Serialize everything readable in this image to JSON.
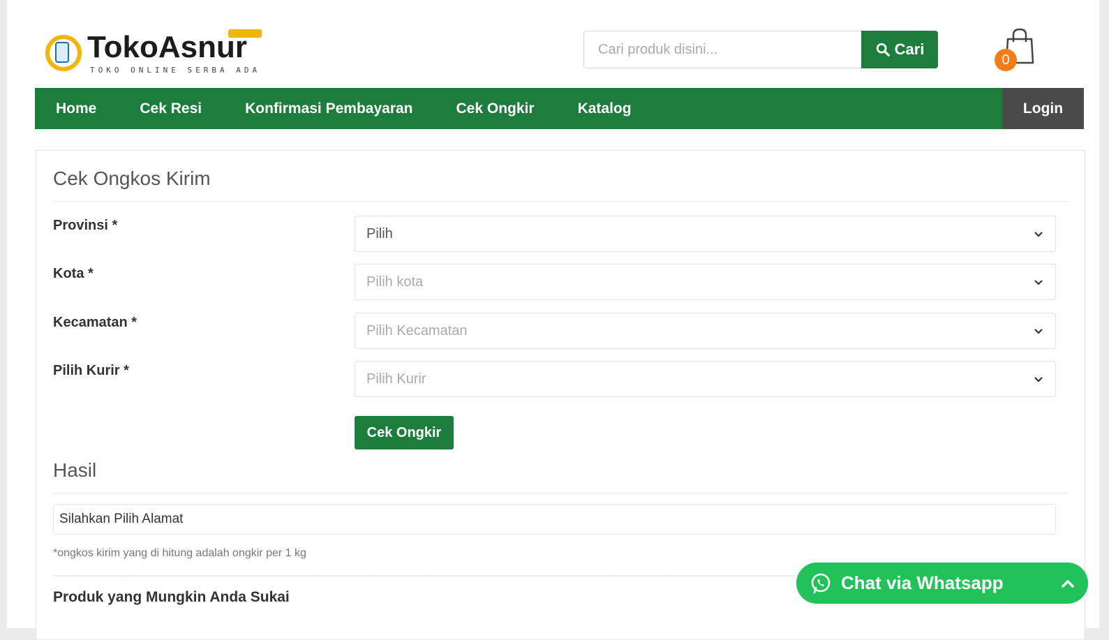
{
  "brand": {
    "name": "TokoAsnur",
    "tagline": "TOKO ONLINE SERBA ADA"
  },
  "search": {
    "placeholder": "Cari produk disini...",
    "button_label": "Cari"
  },
  "cart": {
    "count": "0"
  },
  "nav": {
    "items": [
      {
        "label": "Home"
      },
      {
        "label": "Cek Resi"
      },
      {
        "label": "Konfirmasi Pembayaran"
      },
      {
        "label": "Cek Ongkir"
      },
      {
        "label": "Katalog"
      }
    ],
    "login_label": "Login"
  },
  "form": {
    "title": "Cek Ongkos Kirim",
    "fields": [
      {
        "label": "Provinsi *",
        "value": "Pilih"
      },
      {
        "label": "Kota *",
        "value": "Pilih kota"
      },
      {
        "label": "Kecamatan *",
        "value": "Pilih Kecamatan"
      },
      {
        "label": "Pilih Kurir *",
        "value": "Pilih Kurir"
      }
    ],
    "submit_label": "Cek Ongkir"
  },
  "result": {
    "title": "Hasil",
    "value": "Silahkan Pilih Alamat",
    "note": "*ongkos kirim yang di hitung adalah ongkir per 1 kg"
  },
  "related": {
    "title": "Produk yang Mungkin Anda Sukai"
  },
  "whatsapp": {
    "label": "Chat via Whatsapp"
  },
  "colors": {
    "primary_green": "#1c7d3c",
    "whatsapp_green": "#22c25a",
    "login_bg": "#4a4a4a",
    "badge_orange": "#f57c18",
    "logo_yellow": "#f5b400"
  }
}
